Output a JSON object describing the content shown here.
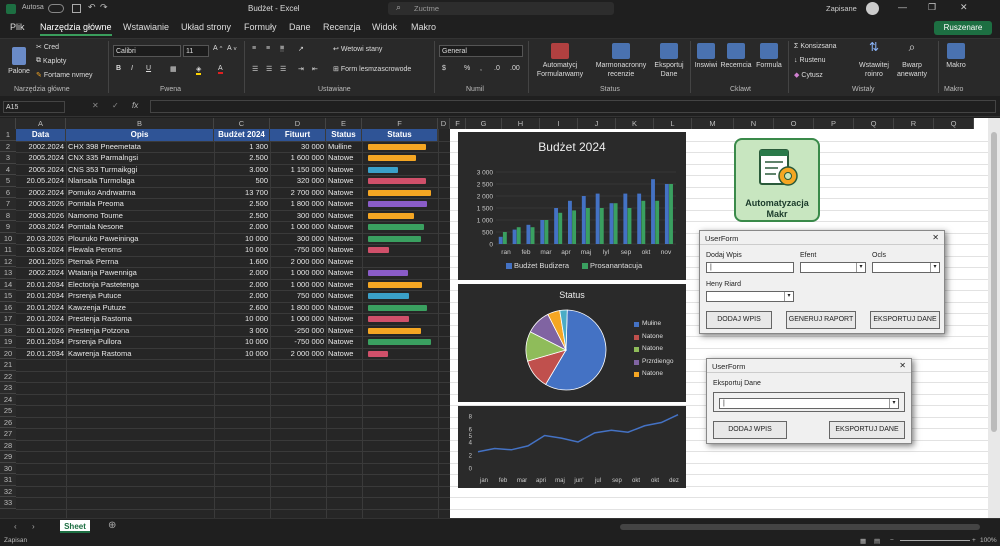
{
  "titlebar": {
    "autosave": "Autosa",
    "title": "Budżet - Excel",
    "search_placeholder": "Zuctme",
    "saved": "Zapisane"
  },
  "ribbon_tabs": [
    "Plik",
    "Narzędzia główne",
    "Wstawianie",
    "Układ strony",
    "Formuły",
    "Dane",
    "Recenzja",
    "Widok",
    "Makro"
  ],
  "share_label": "Ruszenare",
  "ribbon": {
    "paste": "Palone",
    "clip_items": [
      "Cred",
      "Kaploty",
      "Fortame nvmey"
    ],
    "group_clip": "Narzędzia główne",
    "font": "Calibri",
    "font_size": "11",
    "group_font": "Fwena",
    "wrap": "Wetowi stany",
    "merge": "Form lesmzascrowode",
    "group_align": "Ustawiane",
    "number_format": "General",
    "group_number": "Numil",
    "styles_btns": [
      "Automatycj Formularwamy",
      "Marmonacronny recenzie",
      "Eksportuj Dane"
    ],
    "group_styles": "Status",
    "cells_btns": [
      "Inswiwi",
      "Recemcia",
      "Formula"
    ],
    "group_cells": "Cklawt",
    "edit_items": [
      "Konsizsana",
      "Rustenu",
      "Cytusz"
    ],
    "edit_btns": [
      "Wstawitej roinro",
      "Bwarp anewanty"
    ],
    "group_edit": "Wistaly",
    "macro_btn": "Makro",
    "group_macro": "Makro"
  },
  "formula_bar": {
    "cell_ref": "A15",
    "fx": "fx"
  },
  "columns": [
    "A",
    "B",
    "C",
    "D",
    "E",
    "F",
    "D",
    "F",
    "G",
    "H",
    "I",
    "J",
    "K",
    "L",
    "M",
    "N",
    "O",
    "P",
    "Q",
    "R",
    "Q"
  ],
  "table": {
    "headers": [
      "Data",
      "Opis",
      "Budżet 2024",
      "Fituurt",
      "Status",
      "Status"
    ],
    "rows": [
      [
        "2002.2024",
        "CHX 398 Pneemetata",
        "1 300",
        "30 000",
        "Mułline",
        "#f5a623"
      ],
      [
        "2005.2024",
        "CNX 335 Parmalngsi",
        "2.500",
        "1 600 000",
        "Natowe",
        "#f5a623"
      ],
      [
        "2005.2024",
        "CNS 353 Turmaikggi",
        "3.000",
        "1 150 000",
        "Natowe",
        "#3aa0c8"
      ],
      [
        "20.05.2024",
        "Nlansala Turmolaga",
        "500",
        "320 000",
        "Natowe",
        "#d0506a"
      ],
      [
        "2002.2024",
        "Pomuko Andrwatrna",
        "13 700",
        "2 700 000",
        "Natowe",
        "#f5a623"
      ],
      [
        "2003.2026",
        "Pomtala Preoma",
        "2.500",
        "1 800 000",
        "Natowe",
        "#8a5cc8"
      ],
      [
        "2003.2026",
        "Namomo Toume",
        "2.500",
        "300 000",
        "Natowe",
        "#f5a623"
      ],
      [
        "2003.2024",
        "Pomtala Nesone",
        "2.000",
        "1 000 000",
        "Natowe",
        "#3aa060"
      ],
      [
        "20.03.2026",
        "Plouruko Paweininga",
        "10 000",
        "300 000",
        "Natowe",
        "#3aa060"
      ],
      [
        "20.03.2024",
        "Flewala Peroms",
        "10 000",
        "-750 000",
        "Natowe",
        "#d0506a"
      ],
      [
        "2001.2025",
        "Pternak Perrna",
        "1.600",
        "2 000 000",
        "Natowe",
        ""
      ],
      [
        "2002.2024",
        "Wtatanja Pawenniga",
        "2.000",
        "1 000 000",
        "Natowe",
        "#8a5cc8"
      ],
      [
        "20.01.2034",
        "Electonja Pastetenga",
        "2.000",
        "1 000 000",
        "Natowe",
        "#f5a623"
      ],
      [
        "20.01.2034",
        "Prsrenja Putuce",
        "2.000",
        "750 000",
        "Natowe",
        "#3aa0c8"
      ],
      [
        "20.01.2024",
        "Kawzenja Putuze",
        "2.600",
        "1 800 000",
        "Natowe",
        "#3aa060"
      ],
      [
        "20.01.2024",
        "Prestenja Rastoma",
        "10 000",
        "1 000 000",
        "Natowe",
        "#d0506a"
      ],
      [
        "20.01.2026",
        "Prestenja Potzona",
        "3 000",
        "-250 000",
        "Natowe",
        "#f5a623"
      ],
      [
        "20.01.2034",
        "Prsrenja Pullora",
        "10 000",
        "-750 000",
        "Natowe",
        "#3aa060"
      ],
      [
        "20.01.2034",
        "Kawrenja Rastoma",
        "10 000",
        "2 000 000",
        "Natowe",
        "#d0506a"
      ]
    ]
  },
  "bar_fills": [
    0.88,
    0.72,
    0.46,
    0.88,
    0.95,
    0.9,
    0.7,
    0.85,
    0.8,
    0.32,
    0,
    0.6,
    0.82,
    0.62,
    0.9,
    0.62,
    0.8,
    0.95,
    0.3
  ],
  "row_count": 40,
  "chart_data": [
    {
      "type": "bar",
      "title": "Budżet 2024",
      "categories": [
        "ran",
        "feb",
        "mar",
        "apr",
        "maj",
        "lyl",
        "sep",
        "okt",
        "nov"
      ],
      "ylim": [
        0,
        3000
      ],
      "yticks": [
        "0",
        "500",
        "1 000",
        "1 500",
        "2 000",
        "2 500",
        "3 000"
      ],
      "series": [
        {
          "name": "Budżet Budizera",
          "color": "#4472c4",
          "values": [
            300,
            600,
            800,
            1000,
            1500,
            1800,
            2000,
            2100,
            1700,
            2100,
            2100,
            2700,
            2500
          ]
        },
        {
          "name": "Prosanantacuja",
          "color": "#3aa060",
          "values": [
            500,
            700,
            700,
            1000,
            1300,
            1400,
            1500,
            1500,
            1700,
            1500,
            1800,
            1800,
            2500
          ]
        }
      ]
    },
    {
      "type": "pie",
      "title": "Status",
      "slices": [
        {
          "label": "Mułine",
          "value": 58,
          "color": "#4472c4"
        },
        {
          "label": "Natone",
          "value": 12,
          "color": "#c0504d"
        },
        {
          "label": "Natone",
          "value": 12,
          "color": "#8fbc5a"
        },
        {
          "label": "Przrdiengo",
          "value": 10,
          "color": "#8064a2"
        },
        {
          "label": "Natone",
          "value": 5,
          "color": "#f5a623"
        },
        {
          "label": "",
          "value": 3,
          "color": "#4bacc6"
        }
      ]
    },
    {
      "type": "line",
      "categories": [
        "jan",
        "feb",
        "mar",
        "apri",
        "maj",
        "jun'",
        "jul",
        "sep",
        "okt",
        "okt",
        "dez"
      ],
      "ylim": [
        0,
        8
      ],
      "yticks": [
        "0",
        "2",
        "4",
        "5",
        "6",
        "8"
      ],
      "series": [
        {
          "name": "",
          "color": "#4472c4",
          "values": [
            2.5,
            3,
            2.8,
            3.4,
            5,
            4.6,
            4,
            5.4,
            5.8,
            5.5,
            6.5,
            7,
            8.2
          ]
        }
      ]
    }
  ],
  "macro_button": {
    "line1": "Automatyzacja",
    "line2": "Makr"
  },
  "userform1": {
    "title": "UserForm",
    "label_add": "Dodaj Wpis",
    "label_efent": "Efent",
    "label_ocls": "Ocls",
    "label_heny": "Heny Riard",
    "btn_add": "DODAJ WPIS",
    "btn_report": "GENERUJ RAPORT",
    "btn_export": "EKSPORTUJ DANE"
  },
  "userform2": {
    "title": "UserForm",
    "label_export": "Eksportuj Dane",
    "btn_add": "DODAJ WPIS",
    "btn_export": "EKSPORTUJ DANE"
  },
  "sheet_tab": "Sheet",
  "status": {
    "left": "Zapisan",
    "zoom": "100%"
  }
}
